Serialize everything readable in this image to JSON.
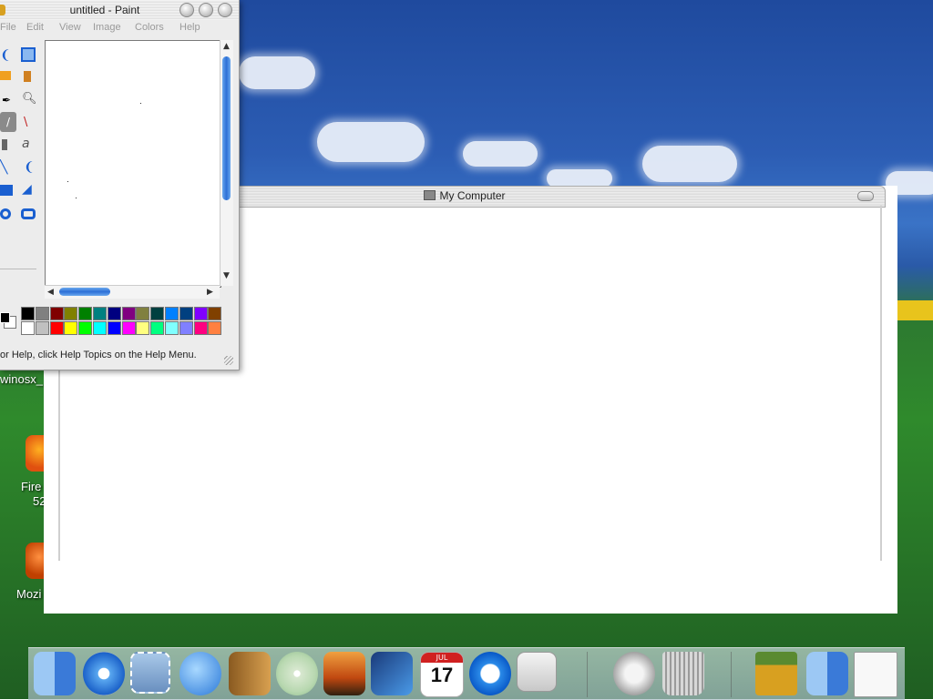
{
  "paint": {
    "title": "untitled - Paint",
    "menu": [
      "File",
      "Edit",
      "View",
      "Image",
      "Colors",
      "Help"
    ],
    "status": "or Help, click Help Topics on the Help Menu.",
    "palette_row1": [
      "#000000",
      "#808080",
      "#800000",
      "#808000",
      "#008000",
      "#008080",
      "#000080",
      "#800080",
      "#808040",
      "#004040",
      "#0080ff",
      "#004080",
      "#8000ff",
      "#804000"
    ],
    "palette_row2": [
      "#ffffff",
      "#c0c0c0",
      "#ff0000",
      "#ffff00",
      "#00ff00",
      "#00ffff",
      "#0000ff",
      "#ff00ff",
      "#ffff80",
      "#00ff80",
      "#80ffff",
      "#8080ff",
      "#ff0080",
      "#ff8040"
    ],
    "foreground": "#000000",
    "background": "#ffffff"
  },
  "my_computer": {
    "title": "My Computer"
  },
  "desktop": {
    "labels": [
      "winosx_",
      "Fire",
      "52",
      "Mozi"
    ]
  },
  "dock": {
    "items": [
      "finder-icon",
      "safari-icon",
      "mail-stamp-icon",
      "ichat-icon",
      "address-book-icon",
      "itunes-icon",
      "iphoto-icon",
      "imovie-icon",
      "ical-icon",
      "quicktime-icon",
      "system-preferences-icon",
      "mail-icon",
      "trash-icon",
      "pencils-icon",
      "finder-icon",
      "window-thumbnail-icon"
    ],
    "ical_month": "JUL",
    "ical_day": "17"
  },
  "colors": {
    "accent": "#2c6fd6",
    "dock": "#b8cbd2"
  }
}
